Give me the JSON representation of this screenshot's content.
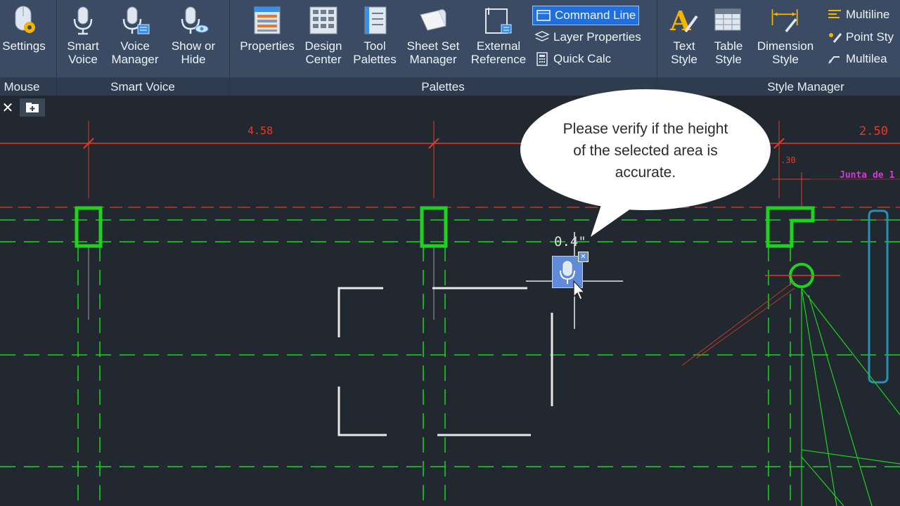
{
  "ribbon": {
    "groups": {
      "mouse": "Mouse",
      "smart_voice": "Smart Voice",
      "palettes": "Palettes",
      "style_manager": "Style Manager"
    },
    "tools": {
      "settings": "Settings",
      "smart_voice": "Smart\nVoice",
      "voice_manager": "Voice\nManager",
      "show_or_hide": "Show or\nHide",
      "properties": "Properties",
      "design_center": "Design\nCenter",
      "tool_palettes": "Tool\nPalettes",
      "sheet_set_manager": "Sheet Set\nManager",
      "external_reference": "External\nReference",
      "text_style": "Text\nStyle",
      "table_style": "Table\nStyle",
      "dimension_style": "Dimension\nStyle"
    },
    "small_tools": {
      "command_line": "Command Line",
      "layer_properties": "Layer Properties",
      "quick_calc": "Quick Calc",
      "multiline": "Multiline",
      "point_style": "Point Sty",
      "multileader": "Multilea"
    }
  },
  "canvas": {
    "dimensions": {
      "d1": "4.58",
      "d2": "2.50",
      "d3": ".30"
    },
    "annotation": "Junta de 1",
    "cursor_readout": "0.4\"",
    "bubble": "Please verify if the height of the selected area is accurate."
  },
  "colors": {
    "ribbon_bg": "#3b4b63",
    "canvas_bg": "#212830",
    "dim_red": "#e43a2a",
    "grid_green": "#1fd21f",
    "accent_blue": "#1f6fe0"
  }
}
